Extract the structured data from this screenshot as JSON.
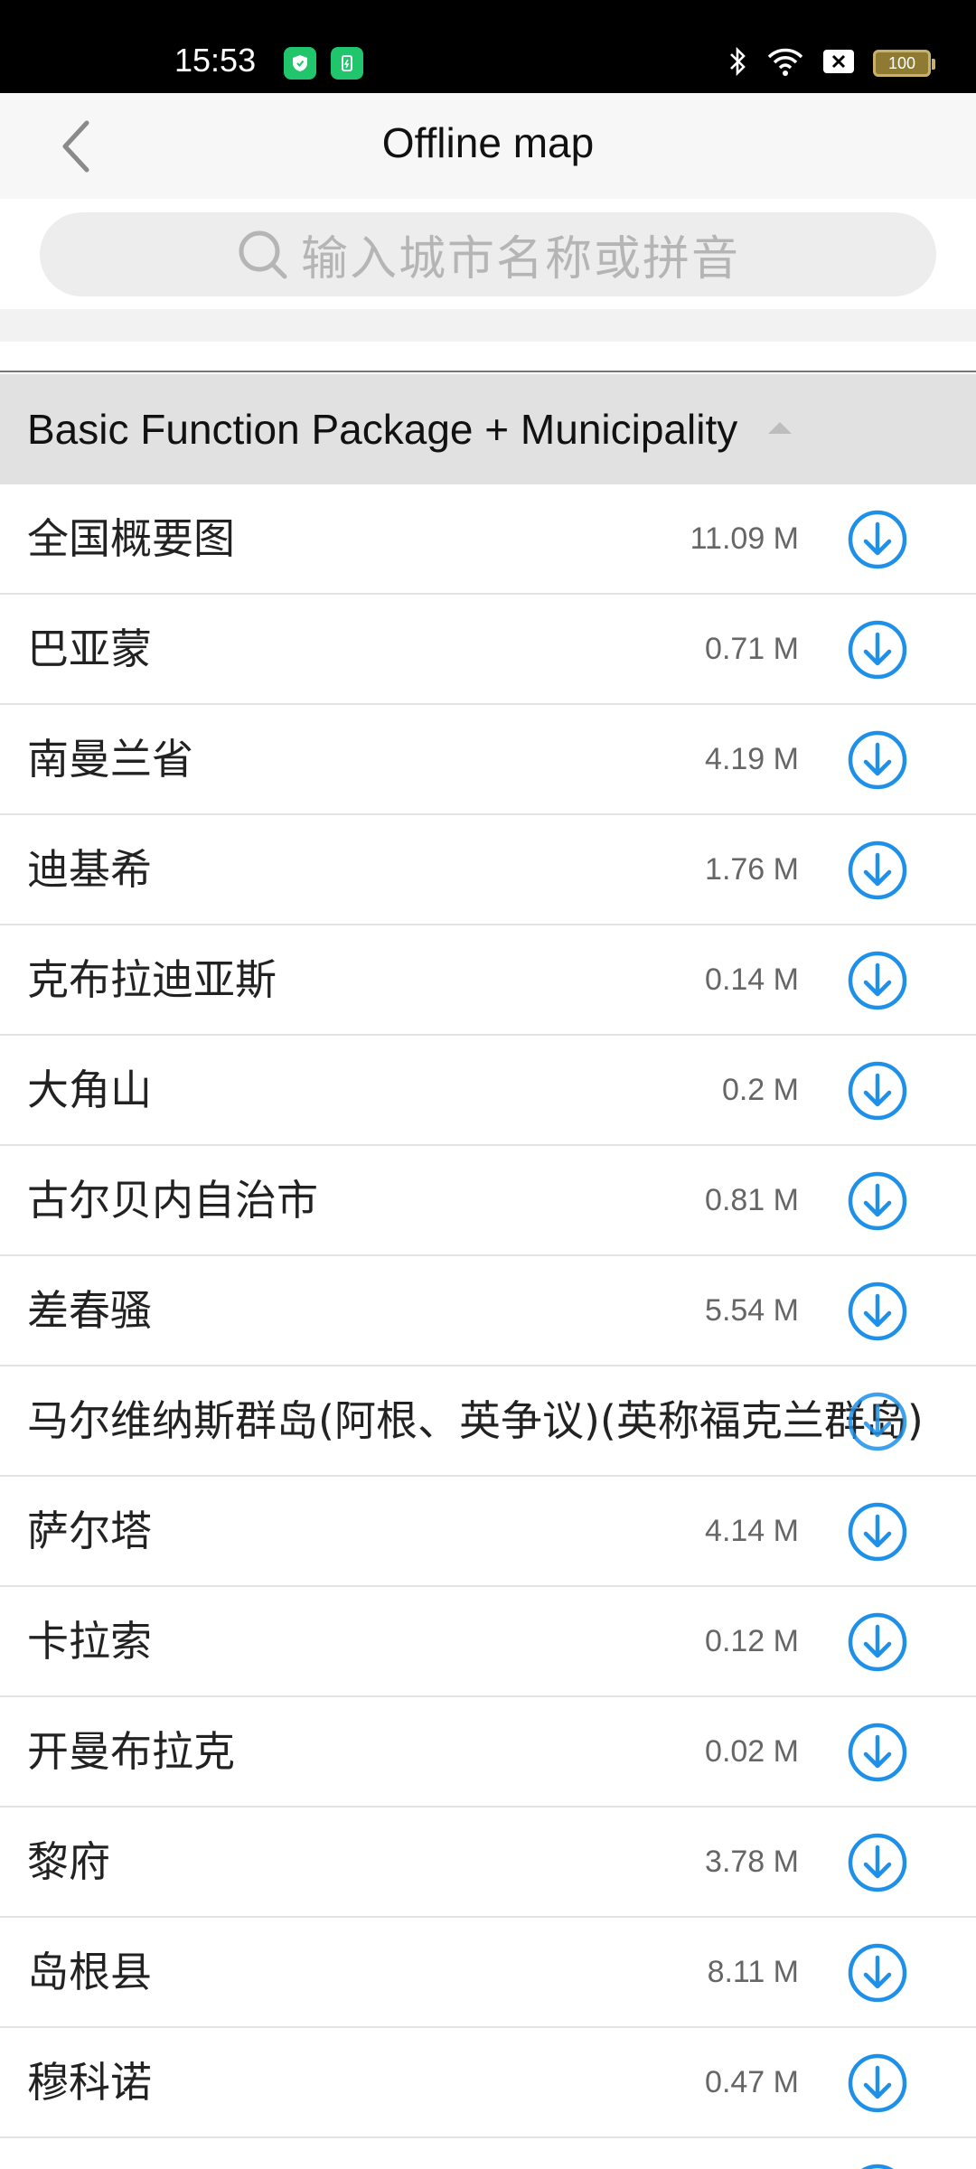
{
  "status_bar": {
    "time": "15:53",
    "battery": "100"
  },
  "header": {
    "title": "Offline map"
  },
  "search": {
    "placeholder": "输入城市名称或拼音"
  },
  "section": {
    "title": "Basic Function Package + Municipality"
  },
  "colors": {
    "accent": "#1e90e8",
    "section_bg": "#e1e1e1"
  },
  "items": [
    {
      "name": "全国概要图",
      "size": "11.09 M"
    },
    {
      "name": "巴亚蒙",
      "size": "0.71 M"
    },
    {
      "name": "南曼兰省",
      "size": "4.19 M"
    },
    {
      "name": "迪基希",
      "size": "1.76 M"
    },
    {
      "name": "克布拉迪亚斯",
      "size": "0.14 M"
    },
    {
      "name": "大角山",
      "size": "0.2 M"
    },
    {
      "name": "古尔贝内自治市",
      "size": "0.81 M"
    },
    {
      "name": "差春骚",
      "size": "5.54 M"
    },
    {
      "name": "马尔维纳斯群岛(阿根、英争议)(英称福克兰群岛)",
      "size": ""
    },
    {
      "name": "萨尔塔",
      "size": "4.14 M"
    },
    {
      "name": "卡拉索",
      "size": "0.12 M"
    },
    {
      "name": "开曼布拉克",
      "size": "0.02 M"
    },
    {
      "name": "黎府",
      "size": "3.78 M"
    },
    {
      "name": "岛根县",
      "size": "8.11 M"
    },
    {
      "name": "穆科诺",
      "size": "0.47 M"
    },
    {
      "name": "",
      "size": ""
    }
  ]
}
